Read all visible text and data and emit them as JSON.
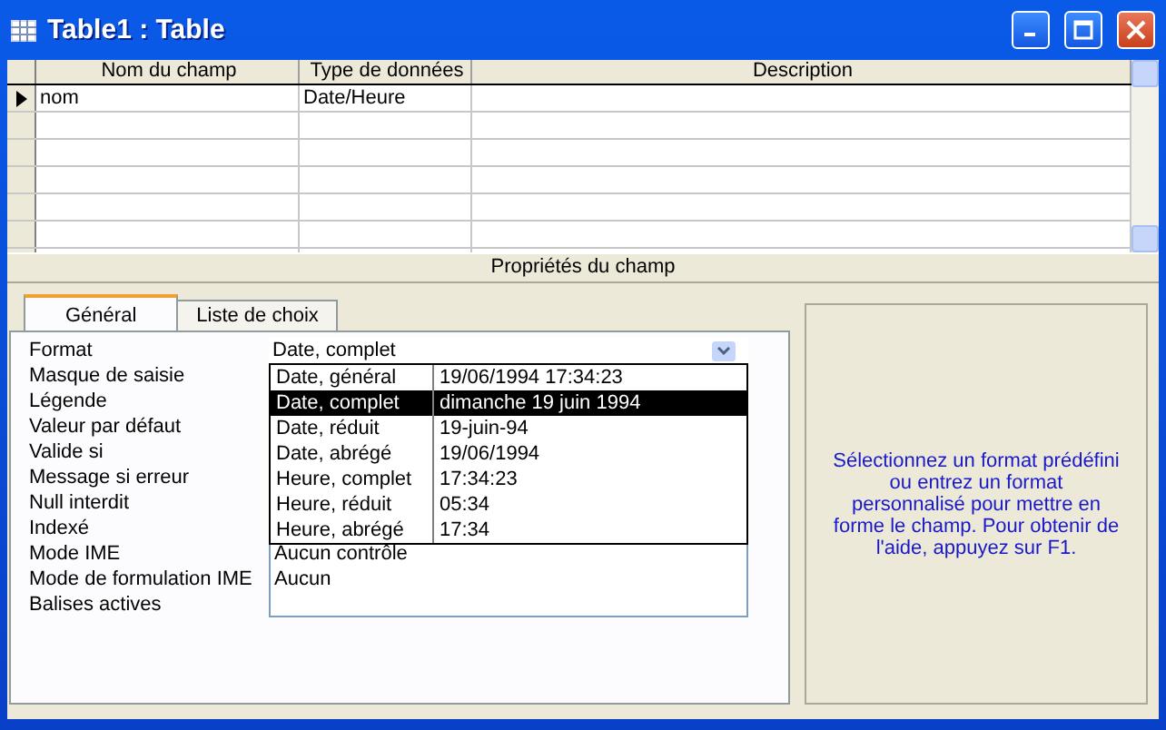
{
  "window": {
    "title": "Table1 : Table"
  },
  "grid": {
    "columns": [
      "Nom du champ",
      "Type de données",
      "Description"
    ],
    "rows": [
      {
        "current": true,
        "cells": [
          "nom",
          "Date/Heure"
        ]
      }
    ]
  },
  "section_title": "Propriétés du champ",
  "tabs": [
    {
      "label": "Général",
      "selected": true
    },
    {
      "label": "Liste de choix",
      "selected": false
    }
  ],
  "properties": [
    {
      "label": "Format",
      "value": "Date, complet",
      "kind": "combo"
    },
    {
      "label": "Masque de saisie",
      "kind": "text"
    },
    {
      "label": "Légende",
      "kind": "text"
    },
    {
      "label": "Valeur par défaut",
      "kind": "text"
    },
    {
      "label": "Valide si",
      "kind": "text"
    },
    {
      "label": "Message si erreur",
      "kind": "text"
    },
    {
      "label": "Null interdit",
      "kind": "text"
    },
    {
      "label": "Indexé",
      "kind": "text"
    },
    {
      "label": "Mode IME",
      "value": "Aucun contrôle",
      "kind": "text"
    },
    {
      "label": "Mode de formulation IME",
      "value": "Aucun",
      "kind": "text"
    },
    {
      "label": "Balises actives",
      "kind": "text"
    }
  ],
  "dropdown": {
    "options": [
      {
        "format": "Date, général",
        "example": "19/06/1994 17:34:23",
        "selected": false
      },
      {
        "format": "Date, complet",
        "example": "dimanche 19 juin 1994",
        "selected": true
      },
      {
        "format": "Date, réduit",
        "example": "19-juin-94",
        "selected": false
      },
      {
        "format": "Date, abrégé",
        "example": "19/06/1994",
        "selected": false
      },
      {
        "format": "Heure, complet",
        "example": "17:34:23",
        "selected": false
      },
      {
        "format": "Heure, réduit",
        "example": "05:34",
        "selected": false
      },
      {
        "format": "Heure, abrégé",
        "example": "17:34",
        "selected": false
      }
    ]
  },
  "help_text": "Sélectionnez un format prédéfini ou entrez un format personnalisé pour mettre en forme le champ. Pour obtenir de l'aide, appuyez sur F1."
}
